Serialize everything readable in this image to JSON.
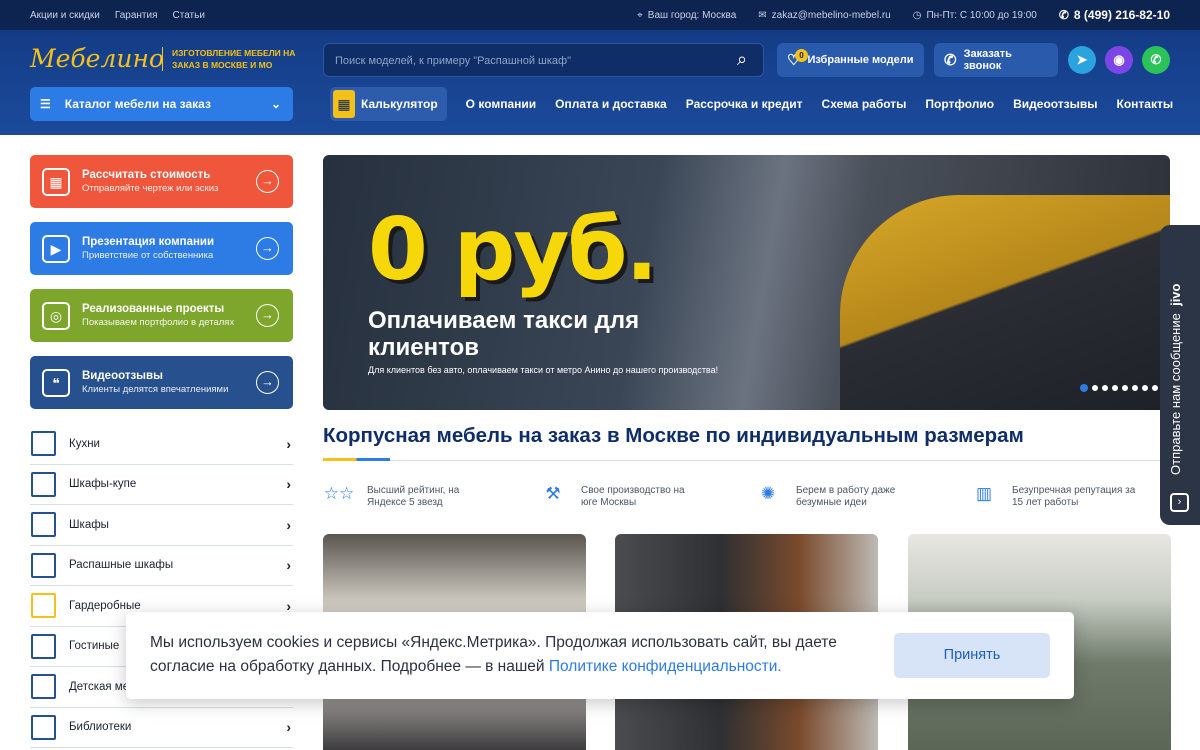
{
  "topbar": {
    "links": [
      "Акции и скидки",
      "Гарантия",
      "Статьи"
    ],
    "city": "Ваш город: Москва",
    "email": "zakaz@mebelino-mebel.ru",
    "hours": "Пн-Пт: С 10:00 до 19:00",
    "phone": "8 (499) 216-82-10"
  },
  "header": {
    "logo": "Мебелино",
    "tagline": "Изготовление мебели на заказ в Москве и МО",
    "search_placeholder": "Поиск моделей, к примеру \"Распашной шкаф\"",
    "favorites_label": "Избранные модели",
    "favorites_count": "0",
    "callback_label": "Заказать звонок",
    "catalog_label": "Каталог мебели на заказ"
  },
  "nav": {
    "calculator": "Калькулятор",
    "items": [
      "О компании",
      "Оплата и доставка",
      "Рассрочка и кредит",
      "Схема работы",
      "Портфолио",
      "Видеоотзывы",
      "Контакты"
    ]
  },
  "sidebar": {
    "actions": [
      {
        "title": "Рассчитать стоимость",
        "subtitle": "Отправляйте чертеж или эскиз",
        "color": "#f0563b"
      },
      {
        "title": "Презентация компании",
        "subtitle": "Приветствие от собственника",
        "color": "#2d7be4"
      },
      {
        "title": "Реализованные проекты",
        "subtitle": "Показываем портфолио в деталях",
        "color": "#7fa62c"
      },
      {
        "title": "Видеоотзывы",
        "subtitle": "Клиенты делятся впечатлениями",
        "color": "#27508f"
      }
    ],
    "categories": [
      "Кухни",
      "Шкафы-купе",
      "Шкафы",
      "Распашные шкафы",
      "Гардеробные",
      "Гостиные",
      "Детская мебель",
      "Библиотеки"
    ]
  },
  "hero": {
    "price": "0 руб.",
    "headline": "Оплачиваем такси для клиентов",
    "text": "Для клиентов без авто, оплачиваем такси от метро Анино до нашего производства!",
    "slides_total": 8,
    "active_slide": 1
  },
  "main": {
    "title": "Корпусная мебель на заказ в Москве по индивидуальным размерам",
    "features": [
      {
        "text": "Высший рейтинг, на Яндексе 5 звезд",
        "icon": "stars-icon"
      },
      {
        "text": "Свое производство на юге Москвы",
        "icon": "hammer-icon"
      },
      {
        "text": "Берем в работу даже безумные идеи",
        "icon": "lightbulb-icon"
      },
      {
        "text": "Безупречная репутация за 15 лет работы",
        "icon": "building-icon"
      }
    ]
  },
  "cookie": {
    "text": "Мы используем cookies и сервисы «Яндекс.Метрика». Продолжая использовать сайт, вы даете согласие на обработку данных. Подробнее — в нашей ",
    "link": "Политике конфиденциальности.",
    "accept": "Принять"
  },
  "jivo": {
    "label": "Отправьте нам сообщение",
    "brand": "jivo"
  }
}
